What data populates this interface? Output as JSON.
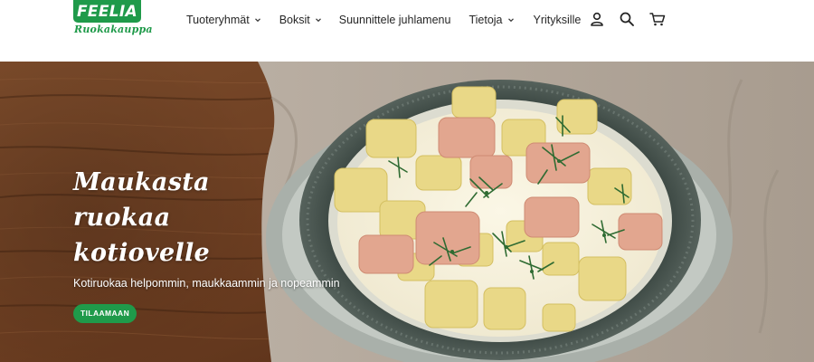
{
  "brand": {
    "name": "FEELIA",
    "tagline": "Ruokakauppa",
    "color": "#1f9a4a"
  },
  "nav": {
    "items": [
      {
        "label": "Tuoteryhmät",
        "dropdown": true
      },
      {
        "label": "Boksit",
        "dropdown": true
      },
      {
        "label": "Suunnittele juhlamenu",
        "dropdown": false
      },
      {
        "label": "Tietoja",
        "dropdown": true
      },
      {
        "label": "Yrityksille",
        "dropdown": false
      }
    ]
  },
  "header_icons": [
    "user-icon",
    "search-icon",
    "cart-icon"
  ],
  "hero": {
    "title_lines": [
      "Maukasta",
      "ruokaa",
      "kotiovelle"
    ],
    "subtitle": "Kotiruokaa helpommin, maukkaammin ja nopeammin",
    "cta_label": "TILAAMAAN",
    "cta_color": "#1f9a4a"
  }
}
